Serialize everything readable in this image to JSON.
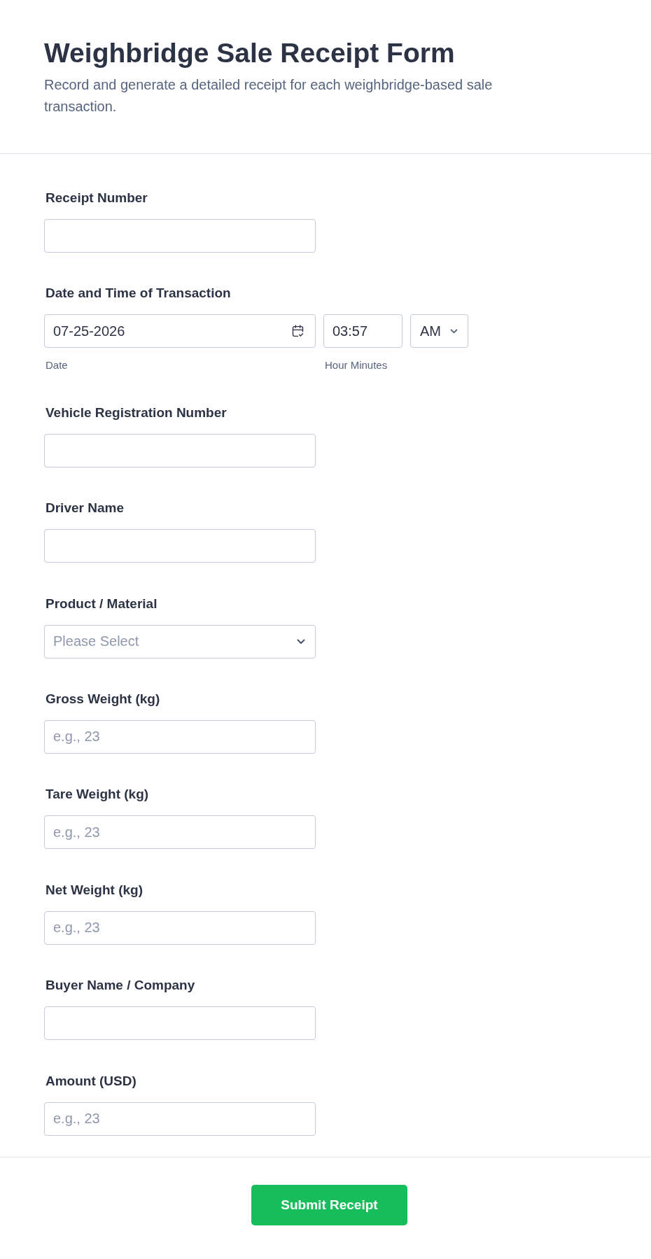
{
  "header": {
    "title": "Weighbridge Sale Receipt Form",
    "description": "Record and generate a detailed receipt for each weighbridge-based sale transaction."
  },
  "fields": [
    {
      "kind": "input",
      "label": "Receipt Number"
    },
    {
      "kind": "datetime",
      "label": "Date and Time of Transaction",
      "date": {
        "value": "07-25-2026",
        "sublabel": "Date"
      },
      "time": {
        "value": "03:57",
        "sublabel": "Hour Minutes"
      },
      "period": {
        "value": "AM"
      }
    },
    {
      "kind": "input",
      "label": "Vehicle Registration Number"
    },
    {
      "kind": "input",
      "label": "Driver Name"
    },
    {
      "kind": "select",
      "label": "Product / Material",
      "placeholder": "Please Select"
    },
    {
      "kind": "input",
      "label": "Gross Weight (kg)",
      "placeholder": "e.g., 23"
    },
    {
      "kind": "input",
      "label": "Tare Weight (kg)",
      "placeholder": "e.g., 23"
    },
    {
      "kind": "input",
      "label": "Net Weight (kg)",
      "placeholder": "e.g., 23"
    },
    {
      "kind": "input",
      "label": "Buyer Name / Company"
    },
    {
      "kind": "input",
      "label": "Amount (USD)",
      "placeholder": "e.g., 23"
    }
  ],
  "submit_button": {
    "label": "Submit Receipt"
  }
}
